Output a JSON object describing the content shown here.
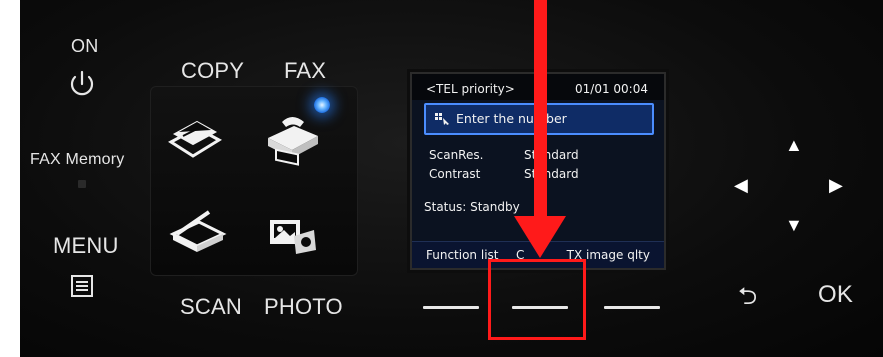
{
  "left_column": {
    "on_label": "ON",
    "fax_memory_label": "FAX Memory",
    "menu_label": "MENU"
  },
  "modes": {
    "copy_label": "COPY",
    "fax_label": "FAX",
    "scan_label": "SCAN",
    "photo_label": "PHOTO"
  },
  "screen": {
    "header_left": "<TEL priority>",
    "header_right": "01/01 00:04",
    "input_text": "Enter the number",
    "settings": [
      {
        "key": "ScanRes.",
        "value": "Standard"
      },
      {
        "key": "Contrast",
        "value": "Standard"
      }
    ],
    "status": "Status: Standby",
    "softkeys": {
      "left": "Function list",
      "middle": "C",
      "right": "TX image qlty"
    }
  },
  "right_controls": {
    "ok_label": "OK",
    "back_symbol": "⮌"
  },
  "colors": {
    "annotation_red": "#ff1a1a",
    "led_blue": "#2f7dff",
    "selection_blue": "#4b8dff"
  },
  "icons": [
    "power-icon",
    "fax-memory-led",
    "menu-icon",
    "copy-icon",
    "fax-icon",
    "scan-icon",
    "photo-icon",
    "dpad-up-icon",
    "dpad-left-icon",
    "dpad-right-icon",
    "dpad-down-icon",
    "back-icon"
  ]
}
